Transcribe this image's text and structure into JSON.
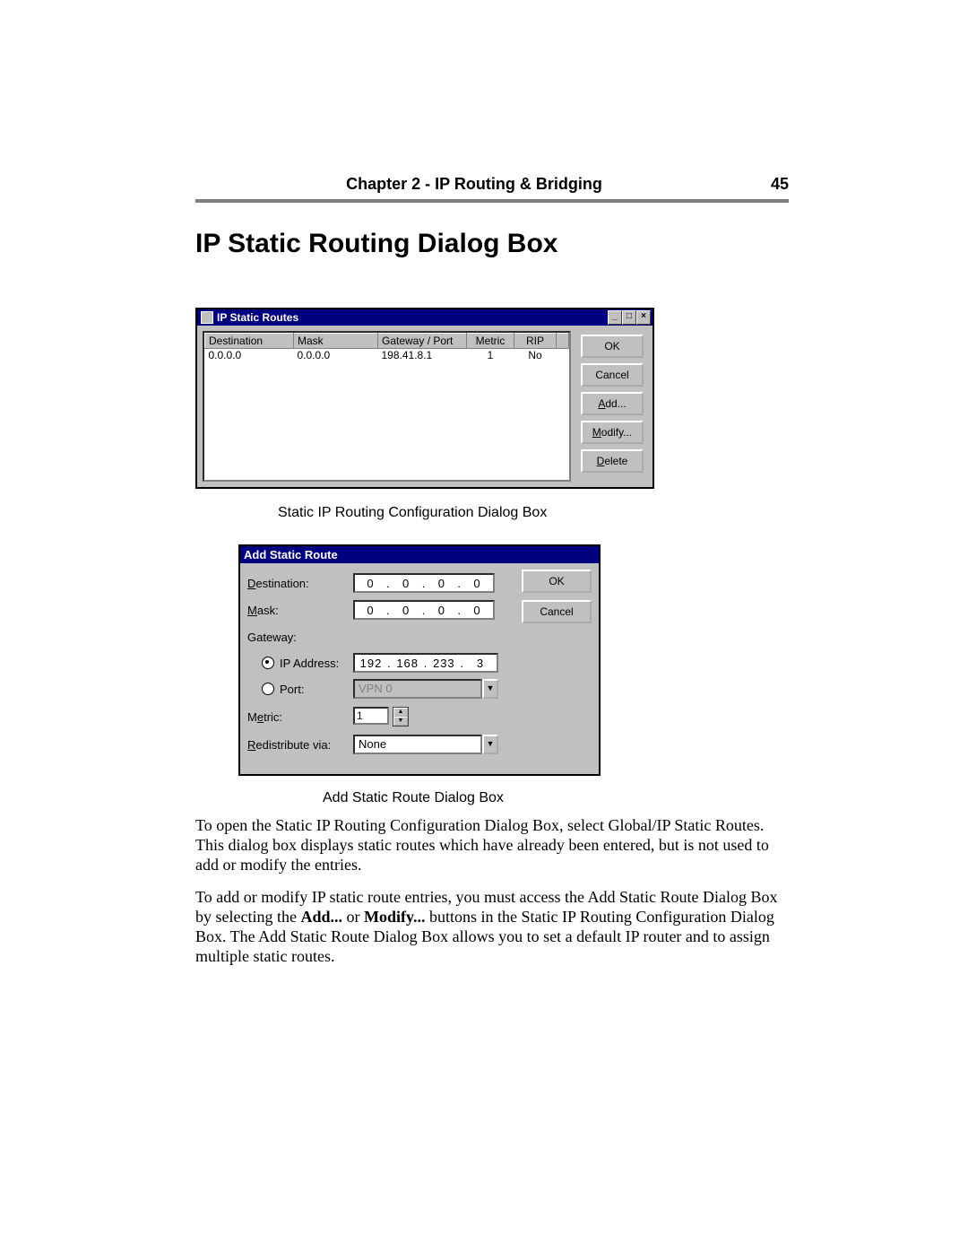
{
  "header": {
    "chapter": "Chapter 2 - IP Routing & Bridging",
    "page_number": "45"
  },
  "section_title": "IP Static Routing Dialog Box",
  "dialog1": {
    "title": "IP Static Routes",
    "columns": [
      "Destination",
      "Mask",
      "Gateway / Port",
      "Metric",
      "RIP"
    ],
    "rows": [
      {
        "destination": "0.0.0.0",
        "mask": "0.0.0.0",
        "gateway": "198.41.8.1",
        "metric": "1",
        "rip": "No"
      }
    ],
    "buttons": {
      "ok": "OK",
      "cancel": "Cancel",
      "add": "Add...",
      "modify": "Modify...",
      "delete": "Delete"
    }
  },
  "caption1": "Static IP Routing Configuration Dialog Box",
  "dialog2": {
    "title": "Add Static Route",
    "labels": {
      "destination": "Destination:",
      "mask": "Mask:",
      "gateway": "Gateway:",
      "ip_address": "IP Address:",
      "port": "Port:",
      "metric": "Metric:",
      "redistribute": "Redistribute via:"
    },
    "destination_ip": [
      "0",
      "0",
      "0",
      "0"
    ],
    "mask_ip": [
      "0",
      "0",
      "0",
      "0"
    ],
    "gateway_ip": [
      "192",
      "168",
      "233",
      "3"
    ],
    "port_value": "VPN 0",
    "metric_value": "1",
    "redistribute_value": "None",
    "buttons": {
      "ok": "OK",
      "cancel": "Cancel"
    }
  },
  "caption2": "Add Static Route Dialog Box",
  "para1_a": "To open the Static IP Routing Configuration Dialog Box, select Global/IP Static Routes. This dialog box displays static routes which have already been entered, but is not used to add or modify the entries.",
  "para2_a": "To add or modify IP static route entries, you must access the Add Static Route Dialog Box by selecting the ",
  "para2_b": "Add...",
  "para2_c": " or ",
  "para2_d": "Modify...",
  "para2_e": " buttons in the Static IP Routing Configuration Dialog Box. The Add Static Route Dialog Box allows you to set a default IP router and to assign multiple static routes."
}
